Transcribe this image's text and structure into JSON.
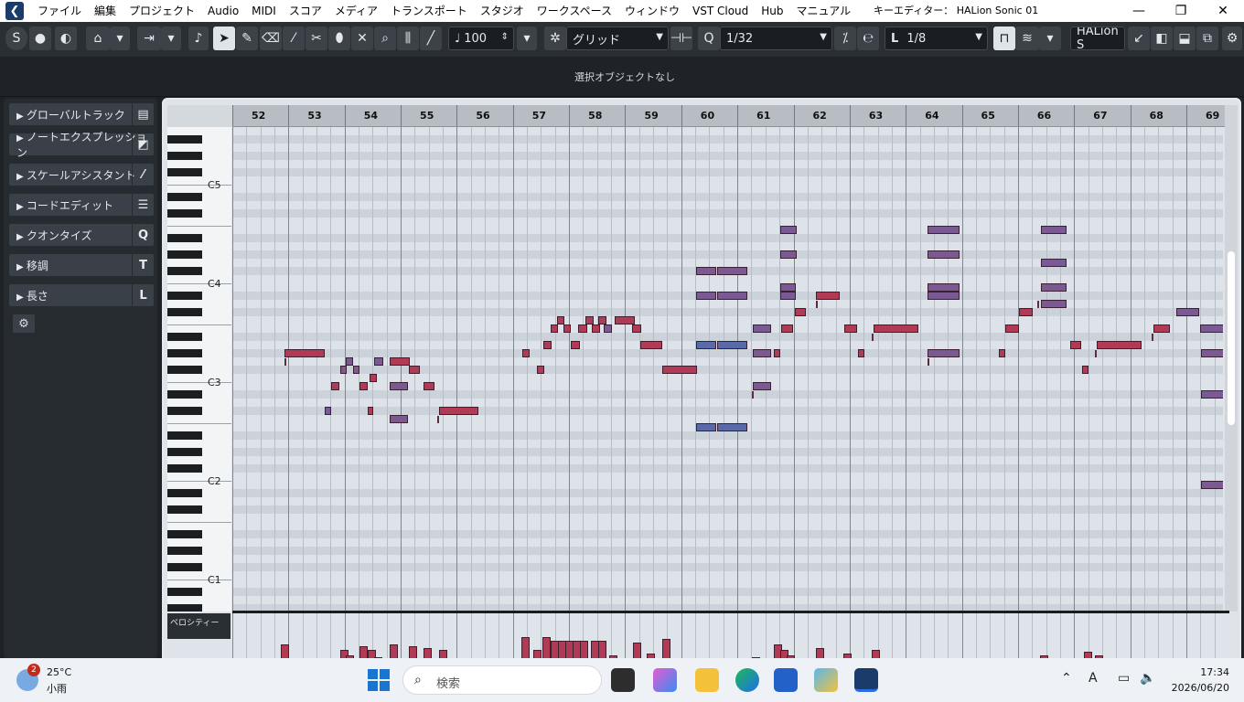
{
  "window": {
    "title": "キーエディター： HALion Sonic 01",
    "menu": [
      "ファイル",
      "編集",
      "プロジェクト",
      "Audio",
      "MIDI",
      "スコア",
      "メディア",
      "トランスポート",
      "スタジオ",
      "ワークスペース",
      "ウィンドウ",
      "VST Cloud",
      "Hub",
      "マニュアル"
    ],
    "minimize": "—",
    "maximize": "❐",
    "close": "✕"
  },
  "toolbar": {
    "velocity_value": "100",
    "snap_mode": "グリッド",
    "quantize_value": "1/32",
    "length_value": "1/8",
    "instrument": "HALion S"
  },
  "status": {
    "text": "選択オブジェクトなし"
  },
  "inspector": {
    "sections": [
      {
        "label": "グローバルトラック",
        "icon": "▤"
      },
      {
        "label": "ノートエクスプレッション",
        "icon": "◩"
      },
      {
        "label": "スケールアシスタント",
        "icon": "⁄"
      },
      {
        "label": "コードエディット",
        "icon": "☰"
      },
      {
        "label": "クオンタイズ",
        "icon": "Q"
      },
      {
        "label": "移調",
        "icon": "T"
      },
      {
        "label": "長さ",
        "icon": "L"
      }
    ]
  },
  "ruler": {
    "bars": [
      "52",
      "53",
      "54",
      "55",
      "56",
      "57",
      "58",
      "59",
      "60",
      "61",
      "62",
      "63",
      "64",
      "65",
      "66",
      "67",
      "68",
      "69"
    ]
  },
  "keyboard": {
    "labels": [
      "C5",
      "C4",
      "C3",
      "C2",
      "C1"
    ]
  },
  "velocity_lane": {
    "label": "ベロシティー"
  },
  "colors": {
    "note_red": "#b13b55",
    "note_purple": "#7b5a93",
    "note_blue": "#5a69a8",
    "grid_bg": "#dee3e9"
  },
  "taskbar": {
    "weather_badge": "2",
    "temperature": "25°C",
    "condition": "小雨",
    "search_placeholder": "検索",
    "time": "17:34",
    "date": "2026/06/20"
  }
}
